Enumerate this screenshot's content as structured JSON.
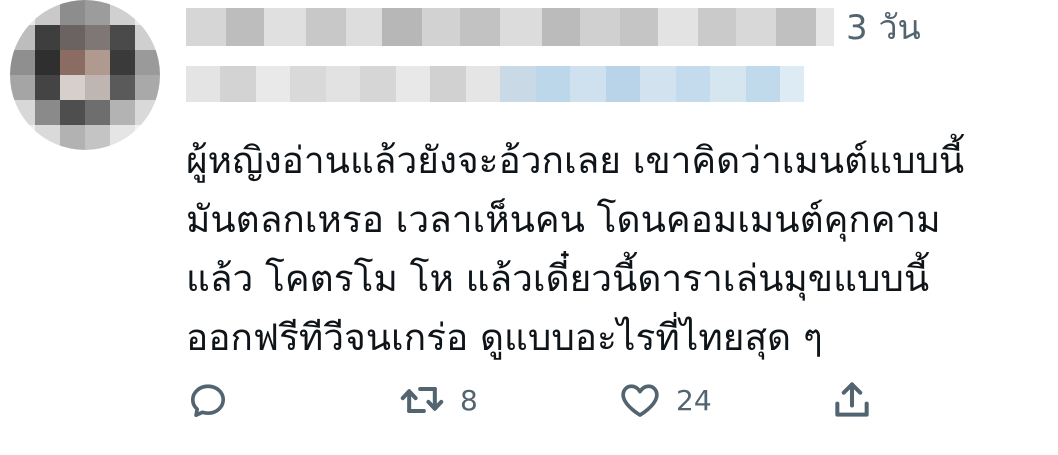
{
  "tweet": {
    "timestamp": "3 วัน",
    "text_lines": [
      "ผู้หญิงอ่านแล้วยังจะอ้วกเลย เขาคิดว่าเมนต์แบบนี้",
      "มันตลกเหรอ เวลาเห็นคน โดนคอมเมนต์คุกคาม",
      "แล้ว โคตรโม โห แล้วเดี๋ยวนี้ดาราเล่นมุขแบบนี้",
      "ออกฟรีทีวีจนเกร่อ ดูแบบอะไรที่ไทยสุด ๆ"
    ],
    "actions": {
      "reply_icon": "reply-icon",
      "retweet_icon": "retweet-icon",
      "retweet_count": "8",
      "like_icon": "heart-icon",
      "like_count": "24",
      "share_icon": "share-icon"
    }
  },
  "colors": {
    "text": "#0f1419",
    "secondary": "#536471"
  }
}
